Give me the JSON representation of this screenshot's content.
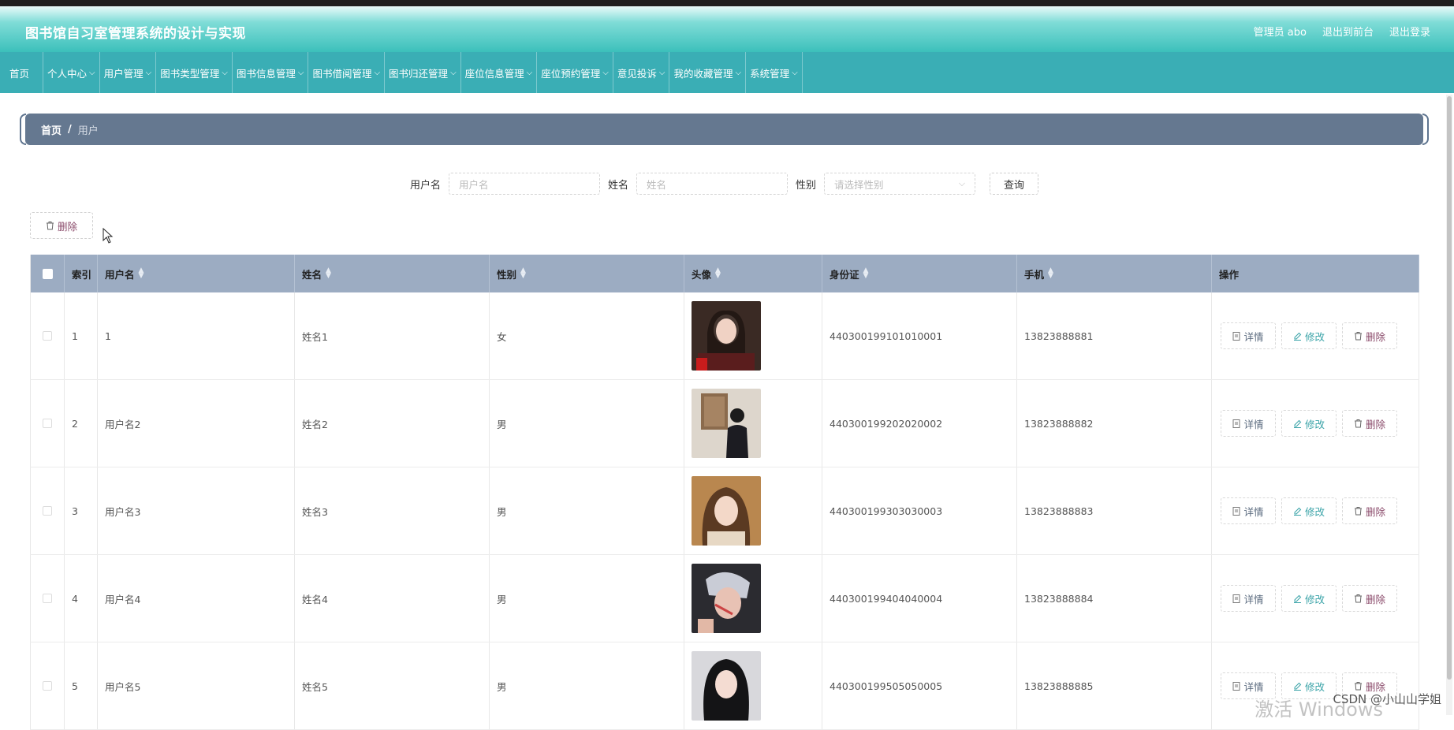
{
  "header": {
    "title": "图书馆自习室管理系统的设计与实现",
    "admin": "管理员 abo",
    "to_front": "退出到前台",
    "logout": "退出登录"
  },
  "nav": {
    "home": "首页",
    "items": [
      "个人中心",
      "用户管理",
      "图书类型管理",
      "图书信息管理",
      "图书借阅管理",
      "图书归还管理",
      "座位信息管理",
      "座位预约管理",
      "意见投诉",
      "我的收藏管理",
      "系统管理"
    ]
  },
  "breadcrumb": {
    "home": "首页",
    "sep": "/",
    "current": "用户"
  },
  "search": {
    "username_label": "用户名",
    "username_placeholder": "用户名",
    "name_label": "姓名",
    "name_placeholder": "姓名",
    "gender_label": "性别",
    "gender_placeholder": "请选择性别",
    "query_button": "查询"
  },
  "bulk_delete": "删除",
  "table": {
    "headers": [
      "索引",
      "用户名",
      "姓名",
      "性别",
      "头像",
      "身份证",
      "手机",
      "操作"
    ],
    "rows": [
      {
        "index": "1",
        "username": "1",
        "name": "姓名1",
        "gender": "女",
        "id_card": "440300199101010001",
        "phone": "13823888881"
      },
      {
        "index": "2",
        "username": "用户名2",
        "name": "姓名2",
        "gender": "男",
        "id_card": "440300199202020002",
        "phone": "13823888882"
      },
      {
        "index": "3",
        "username": "用户名3",
        "name": "姓名3",
        "gender": "男",
        "id_card": "440300199303030003",
        "phone": "13823888883"
      },
      {
        "index": "4",
        "username": "用户名4",
        "name": "姓名4",
        "gender": "男",
        "id_card": "440300199404040004",
        "phone": "13823888884"
      },
      {
        "index": "5",
        "username": "用户名5",
        "name": "姓名5",
        "gender": "男",
        "id_card": "440300199505050005",
        "phone": "13823888885"
      }
    ],
    "actions": {
      "detail": "详情",
      "edit": "修改",
      "delete": "删除"
    }
  },
  "overlay": {
    "activate": "激活 Windows",
    "csdn": "CSDN @小山山学姐"
  },
  "colors": {
    "header_teal": "#3cc0bb",
    "nav_teal": "#3aaeb5",
    "breadcrumb_slate": "#657890",
    "table_head": "#9cacc2"
  }
}
